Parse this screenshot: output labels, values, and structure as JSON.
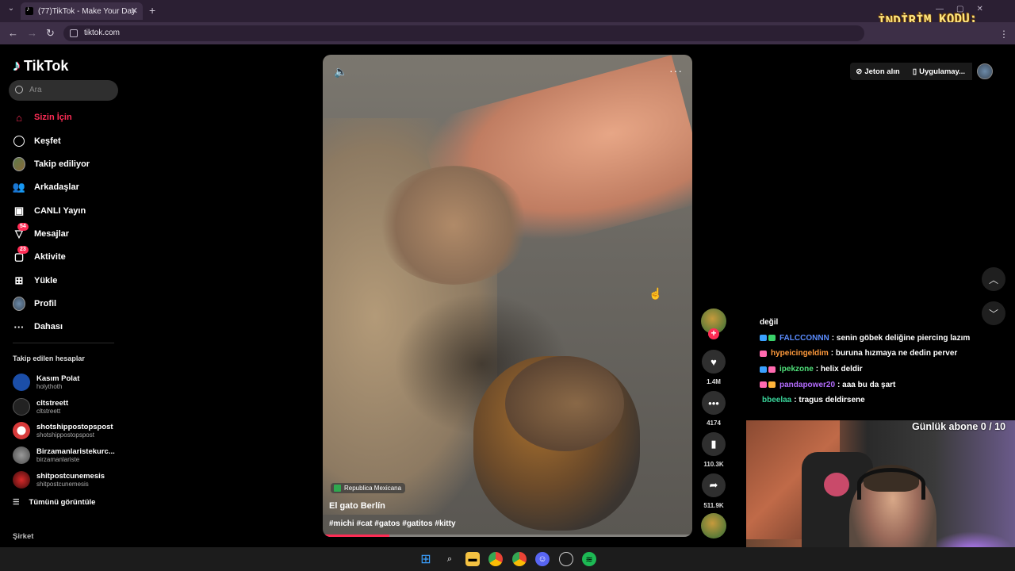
{
  "browser": {
    "tab_title": "(77)TikTok - Make Your Day",
    "url": "tiktok.com",
    "promo_text": "İNDİRİM KODU: \" PERVER \""
  },
  "sidebar": {
    "logo": "TikTok",
    "search_placeholder": "Ara",
    "nav": [
      {
        "label": "Sizin İçin",
        "icon": "home-icon",
        "active": true
      },
      {
        "label": "Keşfet",
        "icon": "compass-icon"
      },
      {
        "label": "Takip ediliyor",
        "icon": "following-avatar-icon"
      },
      {
        "label": "Arkadaşlar",
        "icon": "friends-icon"
      },
      {
        "label": "CANLI Yayın",
        "icon": "live-icon"
      },
      {
        "label": "Mesajlar",
        "icon": "messages-icon",
        "badge": "54"
      },
      {
        "label": "Aktivite",
        "icon": "activity-icon",
        "badge": "23"
      },
      {
        "label": "Yükle",
        "icon": "upload-icon"
      },
      {
        "label": "Profil",
        "icon": "profile-avatar-icon"
      },
      {
        "label": "Dahası",
        "icon": "more-icon"
      }
    ],
    "following_header": "Takip edilen hesaplar",
    "accounts": [
      {
        "name": "Kasım Polat",
        "handle": "holythoth",
        "color": "#1b4ea8"
      },
      {
        "name": "cltstreett",
        "handle": "cltstreett",
        "color": "#222222"
      },
      {
        "name": "shotshippostopspost",
        "handle": "shotshippostopspost",
        "color": "#d83a3a"
      },
      {
        "name": "Birzamanlaristekurc...",
        "handle": "birzamanlariste",
        "color": "#6a6a6a"
      },
      {
        "name": "shitpostcunemesis",
        "handle": "shitpostcunemesis",
        "color": "#8a1a1a"
      }
    ],
    "see_all": "Tümünü görüntüle",
    "company": "Şirket"
  },
  "video": {
    "location": "Republica Mexicana",
    "title": "El gato Berlín",
    "tags": "#michi #cat #gatos #gatitos #kitty",
    "progress": 0.18
  },
  "actions": {
    "likes": "1.4M",
    "comments": "4174",
    "saves": "110.3K",
    "shares": "511.9K"
  },
  "header": {
    "coins": "Jeton alın",
    "get_app": "Uygulamay..."
  },
  "chat": [
    {
      "user": "",
      "message": "değil",
      "user_color": "#ffffff"
    },
    {
      "user": "FALCCONNN",
      "message": ": senin göbek deliğine piercing lazım",
      "user_color": "#5b8dff"
    },
    {
      "user": "hypeicingeldim",
      "message": ": buruna hızmaya ne dedin perver",
      "user_color": "#ff9a3c"
    },
    {
      "user": "ipekzone",
      "message": ": helix deldir",
      "user_color": "#4fe07a"
    },
    {
      "user": "pandapower20",
      "message": ": aaa bu da şart",
      "user_color": "#b46cff"
    },
    {
      "user": "bbeelaa",
      "message": ": tragus deldirsene",
      "user_color": "#39d39a"
    }
  ],
  "stream": {
    "sub_goal": "Günlük abone 0 / 10"
  },
  "colors": {
    "accent": "#fe2c55"
  }
}
